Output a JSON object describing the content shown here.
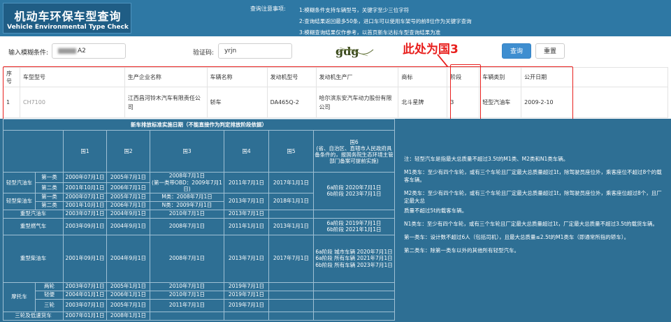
{
  "header": {
    "title_cn": "机动车环保车型查询",
    "title_en": "Vehicle Environmental Type Check",
    "notes_label": "查询注意事项:",
    "notes": [
      "1:模糊条件支持车辆型号，关键字至少三位字符",
      "2:查询结果返回最多50条，进口车可以使用车架号的前8位作为关键字查询",
      "3:模糊查询结果仅作参考，以首页新车达标车型查询结果为准"
    ]
  },
  "search": {
    "model_label": "输入模糊条件:",
    "model_value_suffix": "A2",
    "captcha_label": "验证码:",
    "captcha_value": "yrjn",
    "captcha_image_text": "gdg",
    "query_button": "查询",
    "reset_button": "重置"
  },
  "annotation": {
    "text": "此处为国3",
    "color": "#e8201e"
  },
  "result": {
    "headers": [
      "序号",
      "车型型号",
      "生产企业名称",
      "车辆名称",
      "发动机型号",
      "发动机生产厂",
      "商标",
      "阶段",
      "车辆类别",
      "公开日期"
    ],
    "row": {
      "index": "1",
      "model": "CH7100",
      "maker": "江西昌河铃木汽车有限责任公司",
      "vehicle_name": "轿车",
      "engine_model": "DA465Q-2",
      "engine_maker": "哈尔滨东安汽车动力股份有限公司",
      "brand": "北斗星牌",
      "stage": "3",
      "category": "轻型汽油车",
      "date": "2009-2-10"
    }
  },
  "standards": {
    "caption": "新车排放标准实施日期（不能直接作为判定排放阶段依据）",
    "col_headers": [
      "国1",
      "国2",
      "国3",
      "国4",
      "国5",
      "国6\n(省、自治区、直辖市人民政府具备条件的，报国务院生态环境主管部门备案可提前实施)"
    ],
    "rows": {
      "lgas_label": "轻型汽油车",
      "class1": "第一类",
      "class2": "第二类",
      "lgas1": [
        "2000年07月1日",
        "2005年7月1日"
      ],
      "lgas2": [
        "2001年10月1日",
        "2006年7月1日"
      ],
      "lgas_g3": "2008年7月1日\n(第一类带OBD：2009年7月1日)",
      "lgas_g4": "2011年7月1日",
      "lgas_g5": "2017年1月1日",
      "light_g6": "6a阶段 2020年7月1日\n6b阶段 2023年7月1日",
      "ldsl_label": "轻型柴油车",
      "ldsl1": [
        "2000年07月1日",
        "2005年7月1日"
      ],
      "ldsl2": [
        "2001年10月1日",
        "2006年7月1日"
      ],
      "ldsl_g3_m": "M类：2008年7月1日",
      "ldsl_g3_n": "N类：2009年7月1日",
      "ldsl_g4": "2013年7月1日",
      "ldsl_g5": "2018年1月1日",
      "hgas_label": "重型汽油车",
      "hgas": [
        "2003年07月1日",
        "2004年9月1日",
        "2010年7月1日",
        "2013年7月1日"
      ],
      "hgn_label": "重型燃气车",
      "hgn": [
        "2003年09月1日",
        "2004年9月1日",
        "2008年7月1日",
        "2011年1月1日",
        "2013年1月1日"
      ],
      "hgn_g6": "6a阶段 2019年7月1日\n6b阶段 2021年1月1日",
      "hdsl_label": "重型柴油车",
      "hdsl": [
        "2001年09月1日",
        "2004年9月1日",
        "2008年7月1日",
        "2013年7月1日",
        "2017年7月1日"
      ],
      "hdsl_g6": "6a阶段 城市车辆 2020年7月1日\n6a阶段 所有车辆 2021年7月1日\n6b阶段 所有车辆 2023年7月1日",
      "moto_label": "摩托车",
      "moto_2": "两轮",
      "moto_2_vals": [
        "2003年07月1日",
        "2005年1月1日",
        "2010年7月1日",
        "2019年7月1日"
      ],
      "moto_l": "轻便",
      "moto_l_vals": [
        "2004年01月1日",
        "2006年1月1日",
        "2010年7月1日",
        "2019年7月1日"
      ],
      "moto_3": "三轮",
      "moto_3_vals": [
        "2003年07月1日",
        "2005年7月1日",
        "2011年7月1日",
        "2019年7月1日"
      ],
      "tri_label": "三轮及低速货车",
      "tri_vals": [
        "2007年01月1日",
        "2008年1月1日"
      ]
    },
    "notes": [
      "注：轻型汽车是指最大总质量不超过3.5t的M1类、M2类和N1类车辆。",
      "M1类车：至少有四个车轮，或有三个车轮且厂定最大总质量超过1t，除驾驶员座位外，乘客座位不超过8个的载客车辆。",
      "M2类车：至少有四个车轮，或有三个车轮且厂定最大总质量超过1t，除驾驶员座位外，乘客座位超过8个，且厂定最大总",
      "质量不超过5t的载客车辆。",
      "N1类车：至少有四个车轮，或有三个车轮且厂定最大总质量超过1t，厂定最大总质量不超过3.5t的载货车辆。",
      "第一类车：设计数不超过6人（包括司机），且最大总质量≤2.5t的M1类车（即通常所指的轿车）。",
      "第二类车：除第一类车以外的其他所有轻型汽车。"
    ]
  }
}
